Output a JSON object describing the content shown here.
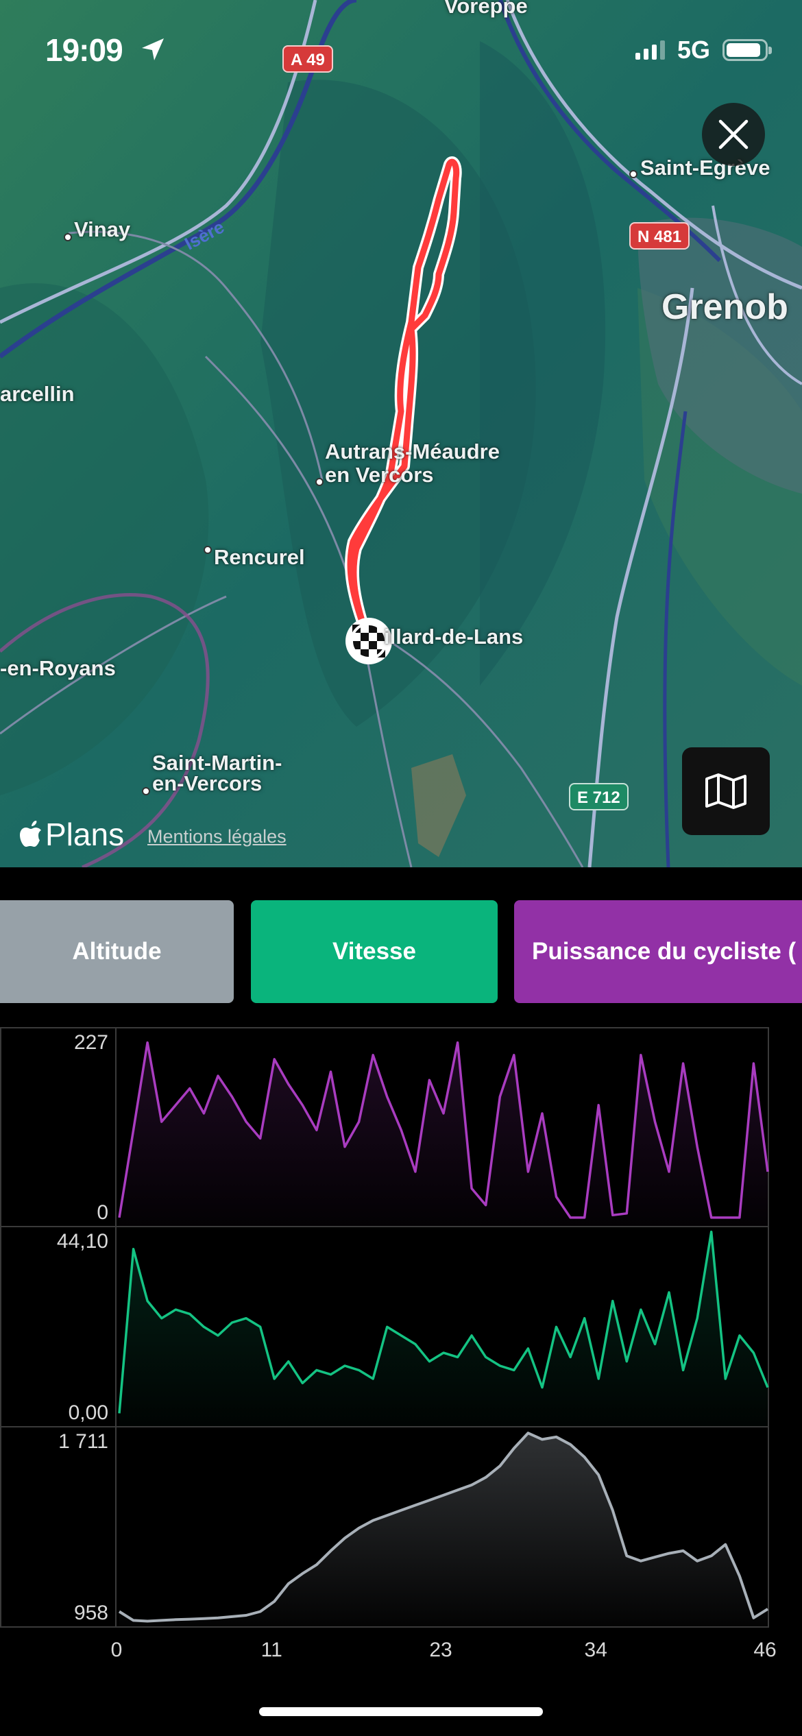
{
  "status_bar": {
    "time": "19:09",
    "network": "5G"
  },
  "map": {
    "places": [
      "Voreppe",
      "Saint-Egrève",
      "Vinay",
      "Grenob",
      "arcellin",
      "Autrans-Méaudre",
      "en Vercors",
      "Rencurel",
      "illard-de-Lans",
      "-en-Royans",
      "Saint-Martin-",
      "en-Vercors"
    ],
    "river_label": "Isère",
    "road_shields": [
      "A 49",
      "N 481",
      "E 712"
    ],
    "attribution": "Plans",
    "legal_link": "Mentions légales",
    "colors": {
      "route": "#ff3b3b",
      "terrain": "#1f6b62"
    }
  },
  "controls": {
    "close_icon": "close-icon",
    "map_type_icon": "map-icon"
  },
  "tabs": [
    {
      "label": "Altitude",
      "color": "#97a1a8"
    },
    {
      "label": "Vitesse",
      "color": "#0ab47c"
    },
    {
      "label": "Puissance du cycliste (",
      "color": "#9231a6"
    }
  ],
  "chart_data": [
    {
      "type": "line",
      "series_color": "#a93cc0",
      "ylim": [
        0,
        227
      ],
      "y_tick_labels": [
        "227",
        "0"
      ],
      "x": [
        0,
        1,
        2,
        3,
        4,
        5,
        6,
        7,
        8,
        9,
        10,
        11,
        12,
        13,
        14,
        15,
        16,
        17,
        18,
        19,
        20,
        21,
        22,
        23,
        24,
        25,
        26,
        27,
        28,
        29,
        30,
        31,
        32,
        33,
        34,
        35,
        36,
        37,
        38,
        39,
        40,
        41,
        42,
        43,
        44,
        45,
        46
      ],
      "y": [
        5,
        110,
        215,
        120,
        140,
        160,
        130,
        175,
        150,
        120,
        100,
        195,
        165,
        140,
        110,
        180,
        90,
        120,
        200,
        150,
        110,
        60,
        170,
        130,
        215,
        40,
        20,
        150,
        200,
        60,
        130,
        30,
        5,
        5,
        140,
        8,
        10,
        200,
        120,
        60,
        190,
        90,
        5,
        5,
        5,
        190,
        60
      ]
    },
    {
      "type": "line",
      "series_color": "#14c383",
      "ylim": [
        0,
        44.1
      ],
      "y_tick_labels": [
        "44,10",
        "0,00"
      ],
      "x": [
        0,
        1,
        2,
        3,
        4,
        5,
        6,
        7,
        8,
        9,
        10,
        11,
        12,
        13,
        14,
        15,
        16,
        17,
        18,
        19,
        20,
        21,
        22,
        23,
        24,
        25,
        26,
        27,
        28,
        29,
        30,
        31,
        32,
        33,
        34,
        35,
        36,
        37,
        38,
        39,
        40,
        41,
        42,
        43,
        44,
        45,
        46
      ],
      "y": [
        2,
        40,
        28,
        24,
        26,
        25,
        22,
        20,
        23,
        24,
        22,
        10,
        14,
        9,
        12,
        11,
        13,
        12,
        10,
        22,
        20,
        18,
        14,
        16,
        15,
        20,
        15,
        13,
        12,
        17,
        8,
        22,
        15,
        24,
        10,
        28,
        14,
        26,
        18,
        30,
        12,
        24,
        44,
        10,
        20,
        16,
        8
      ]
    },
    {
      "type": "area",
      "series_color": "#a8b0b8",
      "ylim": [
        958,
        1711
      ],
      "y_tick_labels": [
        "1 711",
        "958"
      ],
      "x": [
        0,
        1,
        2,
        3,
        4,
        5,
        6,
        7,
        8,
        9,
        10,
        11,
        12,
        13,
        14,
        15,
        16,
        17,
        18,
        19,
        20,
        21,
        22,
        23,
        24,
        25,
        26,
        27,
        28,
        29,
        30,
        31,
        32,
        33,
        34,
        35,
        36,
        37,
        38,
        39,
        40,
        41,
        42,
        43,
        44,
        45,
        46
      ],
      "y": [
        1000,
        965,
        962,
        965,
        968,
        970,
        972,
        975,
        980,
        985,
        1000,
        1040,
        1110,
        1150,
        1185,
        1240,
        1290,
        1330,
        1360,
        1380,
        1400,
        1420,
        1440,
        1460,
        1480,
        1500,
        1530,
        1575,
        1645,
        1705,
        1680,
        1690,
        1660,
        1610,
        1540,
        1400,
        1220,
        1200,
        1215,
        1230,
        1240,
        1200,
        1220,
        1265,
        1140,
        975,
        1010
      ]
    }
  ],
  "x_axis": {
    "tick_labels": [
      "0",
      "11",
      "23",
      "34",
      "46"
    ],
    "xlim": [
      0,
      46
    ]
  }
}
